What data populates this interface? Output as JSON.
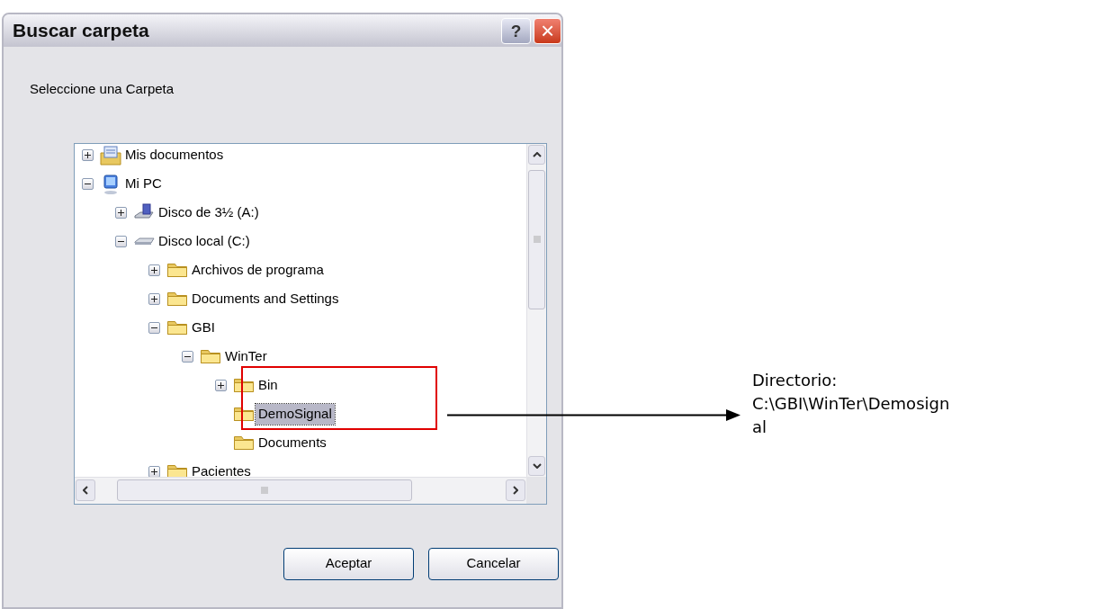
{
  "window": {
    "title": "Buscar carpeta",
    "buttons": [
      "?",
      "×"
    ]
  },
  "prompt": "Seleccione una Carpeta",
  "tree": [
    {
      "label": "Mis documentos",
      "kind": "documents",
      "expanded": false,
      "selected": false
    },
    {
      "label": "Mi PC",
      "kind": "computer",
      "expanded": true,
      "selected": false,
      "children": [
        {
          "label": "Disco de 3½ (A:)",
          "kind": "floppy",
          "expanded": false,
          "selected": false
        },
        {
          "label": "Disco local (C:)",
          "kind": "drive",
          "expanded": true,
          "selected": false,
          "children": [
            {
              "label": "Archivos de programa",
              "kind": "folder",
              "expanded": false,
              "selected": false
            },
            {
              "label": "Documents and Settings",
              "kind": "folder",
              "expanded": false,
              "selected": false
            },
            {
              "label": "GBI",
              "kind": "folder",
              "expanded": true,
              "selected": false,
              "children": [
                {
                  "label": "WinTer",
                  "kind": "folder",
                  "expanded": true,
                  "selected": false,
                  "children": [
                    {
                      "label": "Bin",
                      "kind": "folder",
                      "expanded": false,
                      "selected": false
                    },
                    {
                      "label": "DemoSignal",
                      "kind": "folder",
                      "selected": true
                    },
                    {
                      "label": "Documents",
                      "kind": "folder",
                      "selected": false
                    }
                  ]
                }
              ]
            },
            {
              "label": "Pacientes",
              "kind": "folder",
              "expanded": false,
              "selected": false
            }
          ]
        }
      ]
    }
  ],
  "buttons": [
    "Aceptar",
    "Cancelar"
  ],
  "annotation": {
    "lines": [
      "Directorio:",
      "C:\\GBI\\WinTer\\Demosign",
      "al"
    ]
  }
}
